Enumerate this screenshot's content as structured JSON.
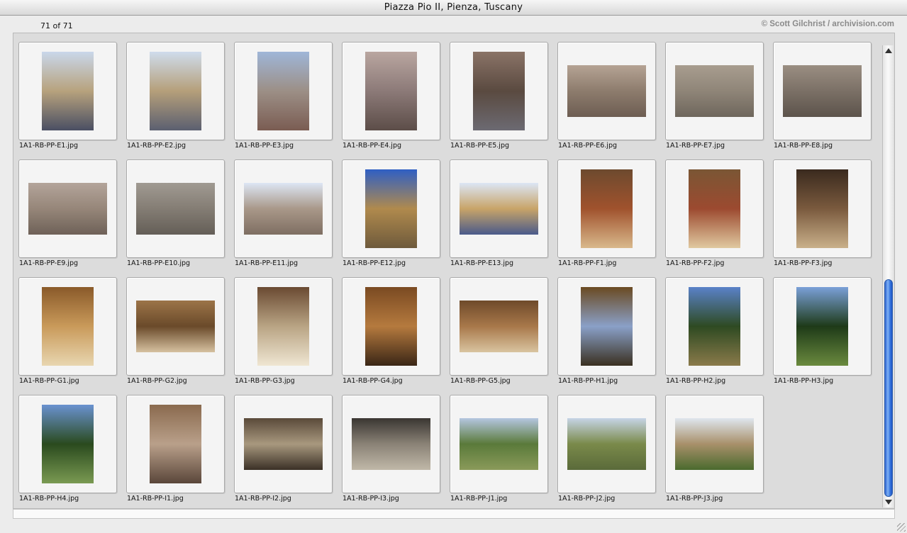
{
  "window": {
    "title": "Piazza Pio II, Pienza, Tuscany",
    "count_label": "71 of 71",
    "credit": "© Scott Gilchrist / archivision.com"
  },
  "images": [
    {
      "name": "1A1-RB-PP-E1.jpg",
      "orientation": "portrait",
      "palette": [
        "#c9d7ea",
        "#b7a27d",
        "#4a4f63"
      ]
    },
    {
      "name": "1A1-RB-PP-E2.jpg",
      "orientation": "portrait",
      "palette": [
        "#cfdcec",
        "#b59f7a",
        "#5b5f70"
      ]
    },
    {
      "name": "1A1-RB-PP-E3.jpg",
      "orientation": "portrait",
      "palette": [
        "#9fb6d8",
        "#9c8f86",
        "#7a5c52"
      ]
    },
    {
      "name": "1A1-RB-PP-E4.jpg",
      "orientation": "portrait",
      "palette": [
        "#b9a6a0",
        "#8c7a78",
        "#5c4d48"
      ]
    },
    {
      "name": "1A1-RB-PP-E5.jpg",
      "orientation": "portrait",
      "palette": [
        "#8a7367",
        "#5a4a40",
        "#6c6a72"
      ]
    },
    {
      "name": "1A1-RB-PP-E6.jpg",
      "orientation": "landscape",
      "palette": [
        "#b5a394",
        "#8d7c6d",
        "#6d5d52"
      ]
    },
    {
      "name": "1A1-RB-PP-E7.jpg",
      "orientation": "landscape",
      "palette": [
        "#a89d8f",
        "#8f8578",
        "#6e665c"
      ]
    },
    {
      "name": "1A1-RB-PP-E8.jpg",
      "orientation": "landscape",
      "palette": [
        "#9a8e82",
        "#7b7066",
        "#5c534b"
      ]
    },
    {
      "name": "1A1-RB-PP-E9.jpg",
      "orientation": "landscape",
      "palette": [
        "#b3a49a",
        "#968679",
        "#6e6158"
      ]
    },
    {
      "name": "1A1-RB-PP-E10.jpg",
      "orientation": "landscape",
      "palette": [
        "#a09a92",
        "#847d74",
        "#645e57"
      ]
    },
    {
      "name": "1A1-RB-PP-E11.jpg",
      "orientation": "landscape",
      "palette": [
        "#dde6f4",
        "#a99889",
        "#7e6e62"
      ]
    },
    {
      "name": "1A1-RB-PP-E12.jpg",
      "orientation": "portrait",
      "palette": [
        "#2f5fc4",
        "#b08a4d",
        "#6e5a3c"
      ]
    },
    {
      "name": "1A1-RB-PP-E13.jpg",
      "orientation": "landscape",
      "palette": [
        "#dce6f5",
        "#c8a468",
        "#4a5a8a"
      ]
    },
    {
      "name": "1A1-RB-PP-F1.jpg",
      "orientation": "portrait",
      "palette": [
        "#6d4a2e",
        "#a0522d",
        "#d9b98c"
      ]
    },
    {
      "name": "1A1-RB-PP-F2.jpg",
      "orientation": "portrait",
      "palette": [
        "#7a5634",
        "#9c4a30",
        "#e0c9a0"
      ]
    },
    {
      "name": "1A1-RB-PP-F3.jpg",
      "orientation": "portrait",
      "palette": [
        "#3a2a1e",
        "#7a5a3e",
        "#c9b08a"
      ]
    },
    {
      "name": "1A1-RB-PP-G1.jpg",
      "orientation": "portrait",
      "palette": [
        "#8a5a2a",
        "#c99a5a",
        "#e8d6b0"
      ]
    },
    {
      "name": "1A1-RB-PP-G2.jpg",
      "orientation": "landscape",
      "palette": [
        "#9c7448",
        "#6a4a2a",
        "#d6c1a0"
      ]
    },
    {
      "name": "1A1-RB-PP-G3.jpg",
      "orientation": "portrait",
      "palette": [
        "#6a4a32",
        "#b9a484",
        "#efe6d2"
      ]
    },
    {
      "name": "1A1-RB-PP-G4.jpg",
      "orientation": "portrait",
      "palette": [
        "#7a4a22",
        "#b57a3e",
        "#3a2616"
      ]
    },
    {
      "name": "1A1-RB-PP-G5.jpg",
      "orientation": "landscape",
      "palette": [
        "#6e4a2a",
        "#a8784a",
        "#d9c4a0"
      ]
    },
    {
      "name": "1A1-RB-PP-H1.jpg",
      "orientation": "portrait",
      "palette": [
        "#6a4a22",
        "#8aa0c8",
        "#3a3020"
      ]
    },
    {
      "name": "1A1-RB-PP-H2.jpg",
      "orientation": "portrait",
      "palette": [
        "#5a82c8",
        "#2e4a22",
        "#8a7a4a"
      ]
    },
    {
      "name": "1A1-RB-PP-H3.jpg",
      "orientation": "portrait",
      "palette": [
        "#7aa0d8",
        "#1e3a18",
        "#6a8a3e"
      ]
    },
    {
      "name": "1A1-RB-PP-H4.jpg",
      "orientation": "portrait",
      "palette": [
        "#6a92d0",
        "#2a4a1e",
        "#7a9a52"
      ]
    },
    {
      "name": "1A1-RB-PP-I1.jpg",
      "orientation": "portrait",
      "palette": [
        "#8a6a4e",
        "#b9a08a",
        "#5a463a"
      ]
    },
    {
      "name": "1A1-RB-PP-I2.jpg",
      "orientation": "landscape",
      "palette": [
        "#5a4a3a",
        "#a8987e",
        "#3a3026"
      ]
    },
    {
      "name": "1A1-RB-PP-I3.jpg",
      "orientation": "landscape",
      "palette": [
        "#3a3632",
        "#8a8276",
        "#c0b8a8"
      ]
    },
    {
      "name": "1A1-RB-PP-J1.jpg",
      "orientation": "landscape",
      "palette": [
        "#b4c6e0",
        "#5a7a3a",
        "#8a9a5a"
      ]
    },
    {
      "name": "1A1-RB-PP-J2.jpg",
      "orientation": "landscape",
      "palette": [
        "#c6d4e6",
        "#7a8a4a",
        "#5a6a3a"
      ]
    },
    {
      "name": "1A1-RB-PP-J3.jpg",
      "orientation": "landscape",
      "palette": [
        "#dfe6ee",
        "#a8906a",
        "#4a6a2e"
      ]
    }
  ],
  "scrollbar": {
    "position_fraction": 0.55,
    "visible_fraction": 0.47,
    "thumb_color": "#3a78e0"
  }
}
